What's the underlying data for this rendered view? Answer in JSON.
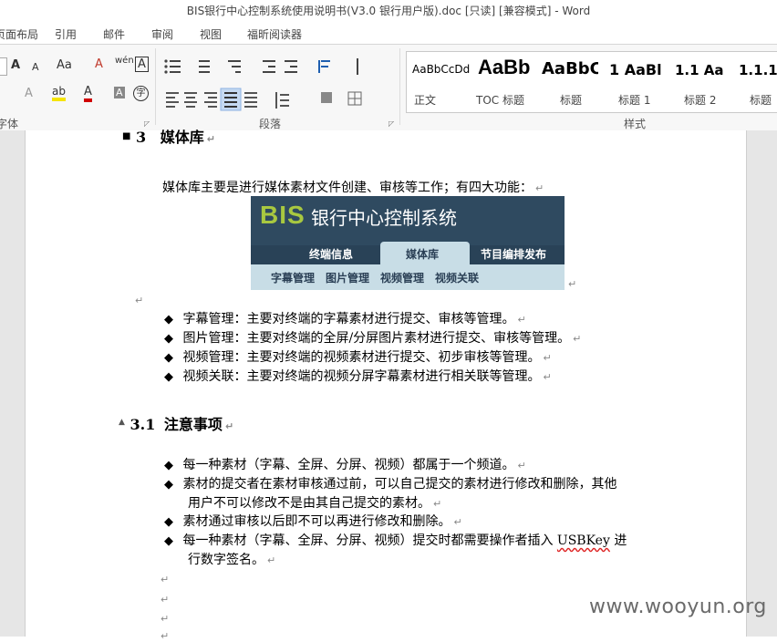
{
  "window": {
    "title": "BIS银行中心控制系统使用说明书(V3.0 银行用户版).doc [只读] [兼容模式] - Word"
  },
  "tabs": [
    "页面布局",
    "引用",
    "邮件",
    "审阅",
    "视图",
    "福昕阅读器"
  ],
  "ribbon": {
    "groups": {
      "font": "字体",
      "paragraph": "段落",
      "styles": "样式"
    },
    "font_buttons": {
      "grow": "A",
      "shrink": "A",
      "case": "Aa",
      "clear": "A",
      "phonetic": "wén",
      "border": "A",
      "effects": "A",
      "highlight": "ab",
      "color": "A",
      "shade": "A",
      "enclose": "字"
    },
    "styles": [
      {
        "sample": "AaBbCcDd",
        "name": "正文"
      },
      {
        "sample": "AaBb",
        "name": "TOC 标题"
      },
      {
        "sample": "AaBbC",
        "name": "标题"
      },
      {
        "sample": "1  AaBl",
        "name": "标题 1"
      },
      {
        "sample": "1.1  Aa",
        "name": "标题 2"
      },
      {
        "sample": "1.1.1",
        "name": "标题"
      }
    ]
  },
  "document": {
    "heading3": {
      "number": "3",
      "text": "媒体库"
    },
    "intro": "媒体库主要是进行媒体素材文件创建、审核等工作；有四大功能：",
    "embed": {
      "logo": "BIS",
      "title": "银行中心控制系统",
      "nav": [
        "终端信息",
        "媒体库",
        "节目编排发布"
      ],
      "sub": [
        "字幕管理",
        "图片管理",
        "视频管理",
        "视频关联"
      ]
    },
    "bullets1": [
      "字幕管理：主要对终端的字幕素材进行提交、审核等管理。",
      "图片管理：主要对终端的全屏/分屏图片素材进行提交、审核等管理。",
      "视频管理：主要对终端的视频素材进行提交、初步审核等管理。",
      "视频关联：主要对终端的视频分屏字幕素材进行相关联等管理。"
    ],
    "heading31": {
      "number": "3.1",
      "text": "注意事项"
    },
    "bullets2": [
      {
        "line1": "每一种素材（字幕、全屏、分屏、视频）都属于一个频道。",
        "line2": ""
      },
      {
        "line1": "素材的提交者在素材审核通过前，可以自己提交的素材进行修改和删除，其他",
        "line2": "用户不可以修改不是由其自己提交的素材。"
      },
      {
        "line1": "素材通过审核以后即不可以再进行修改和删除。",
        "line2": ""
      },
      {
        "line1_pre": "每一种素材（字幕、全屏、分屏、视频）提交时都需要操作者插入 ",
        "line1_word": "USBKey",
        "line1_post": " 进",
        "line2": "行数字签名。"
      }
    ],
    "para_mark": "↵",
    "bullet_mark": "◆"
  },
  "watermark": "www.wooyun.org"
}
